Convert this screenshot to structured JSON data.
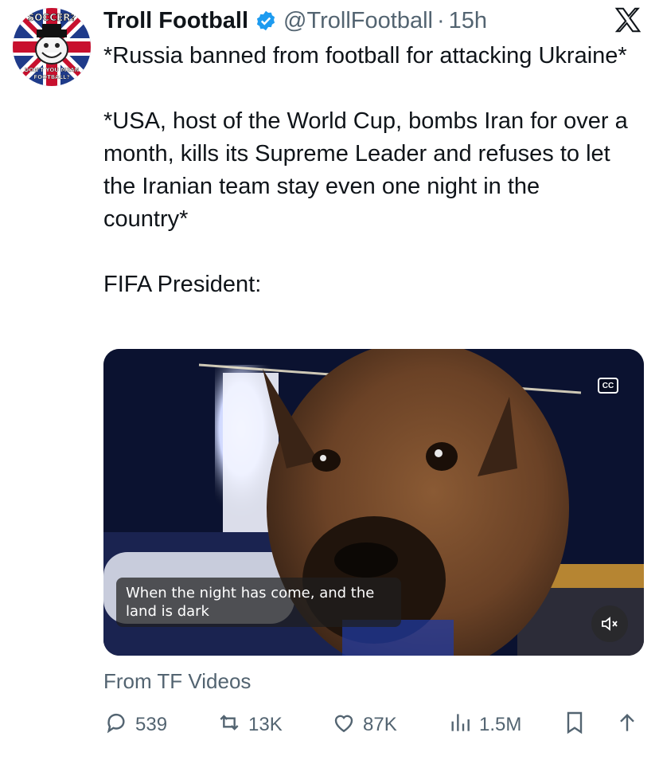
{
  "tweet": {
    "author_name": "Troll Football",
    "handle": "@TrollFootball",
    "dot": "·",
    "time": "15h",
    "avatar": {
      "top_text": "SOCCER?",
      "bottom_text_1": "DON'T YOU MEAN",
      "bottom_text_2": "FOOTBALL?"
    },
    "paragraphs": [
      "*Russia banned from football for attacking Ukraine*",
      "*USA, host of the World Cup, bombs Iran for over a month, kills its Supreme Leader and refuses to let the Iranian team stay even one night in the country*",
      "FIFA President:"
    ],
    "video": {
      "caption_line_1": "When the night has come, and the",
      "caption_line_2": "land is dark",
      "cc_label": "CC"
    },
    "source": "From TF Videos",
    "stats": {
      "replies": "539",
      "retweets": "13K",
      "likes": "87K",
      "views": "1.5M"
    }
  },
  "colors": {
    "accent": "#1d9bf0",
    "secondary_text": "#536471",
    "primary_text": "#0f1419"
  },
  "icons": [
    "verified-badge-icon",
    "x-logo-icon",
    "cc-icon",
    "mute-icon",
    "reply-icon",
    "retweet-icon",
    "like-icon",
    "views-icon",
    "bookmark-icon",
    "share-icon"
  ]
}
